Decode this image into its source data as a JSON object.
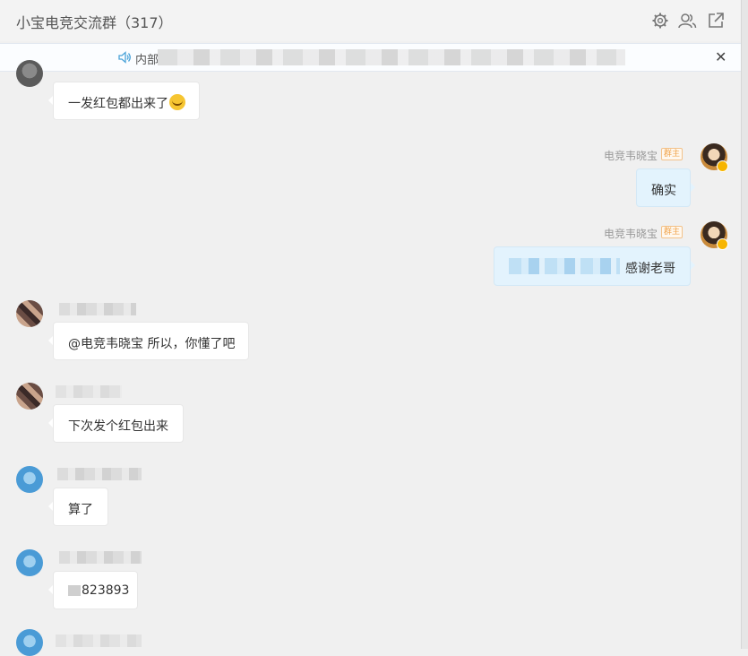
{
  "header": {
    "title": "小宝电竞交流群（317）",
    "icons": [
      "gear-icon",
      "group-members-icon",
      "popout-icon"
    ]
  },
  "notice": {
    "prefix": "内部",
    "icon": "speaker-icon",
    "close_icon": "close-icon"
  },
  "messages": [
    {
      "sender": "",
      "text": "一发红包都出来了"
    },
    {
      "sender": "电竞韦晓宝",
      "badge": "群主",
      "text": "确实"
    },
    {
      "sender": "电竞韦晓宝",
      "badge": "群主",
      "text": "感谢老哥"
    },
    {
      "sender": "",
      "text": "@电竞韦晓宝 所以，你懂了吧"
    },
    {
      "sender": "",
      "text": "下次发个红包出来"
    },
    {
      "sender": "",
      "text": "算了"
    },
    {
      "sender": "",
      "text": "823893"
    }
  ],
  "colors": {
    "background": "#f0f0f0",
    "bubble_incoming": "#ffffff",
    "bubble_outgoing": "#e3f3fd",
    "badge": "#f0a44c"
  }
}
